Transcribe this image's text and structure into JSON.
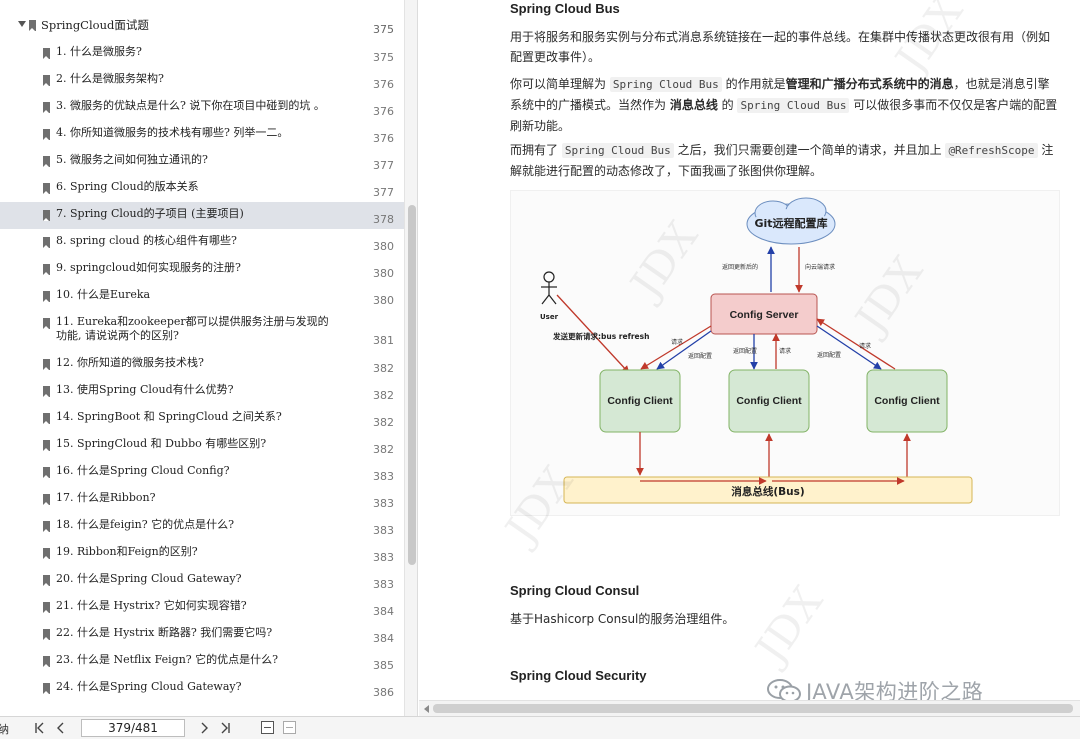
{
  "sidebar": {
    "root": {
      "label": "SpringCloud面试题",
      "page": "375"
    },
    "items": [
      {
        "label": "1. 什么是微服务?",
        "page": "375"
      },
      {
        "label": "2. 什么是微服务架构?",
        "page": "376"
      },
      {
        "label": "3. 微服务的优缺点是什么? 说下你在项目中碰到的坑 。",
        "page": "376"
      },
      {
        "label": "4. 你所知道微服务的技术栈有哪些? 列举一二。",
        "page": "376"
      },
      {
        "label": "5. 微服务之间如何独立通讯的?",
        "page": "377"
      },
      {
        "label": "6. Spring Cloud的版本关系",
        "page": "377"
      },
      {
        "label": "7. Spring Cloud的子项目 (主要项目)",
        "page": "378"
      },
      {
        "label": "8. spring cloud 的核心组件有哪些?",
        "page": "380"
      },
      {
        "label": "9. springcloud如何实现服务的注册?",
        "page": "380"
      },
      {
        "label": "10. 什么是Eureka",
        "page": "380"
      },
      {
        "label": "11. Eureka和zookeeper都可以提供服务注册与发现的功能, 请说说两个的区别?",
        "page": "381"
      },
      {
        "label": "12. 你所知道的微服务技术栈?",
        "page": "382"
      },
      {
        "label": "13. 使用Spring Cloud有什么优势?",
        "page": "382"
      },
      {
        "label": "14. SpringBoot 和 SpringCloud 之间关系?",
        "page": "382"
      },
      {
        "label": "15. SpringCloud 和 Dubbo 有哪些区别?",
        "page": "382"
      },
      {
        "label": "16. 什么是Spring Cloud Config?",
        "page": "383"
      },
      {
        "label": "17. 什么是Ribbon?",
        "page": "383"
      },
      {
        "label": "18. 什么是feigin? 它的优点是什么?",
        "page": "383"
      },
      {
        "label": "19. Ribbon和Feign的区别?",
        "page": "383"
      },
      {
        "label": "20. 什么是Spring Cloud Gateway?",
        "page": "383"
      },
      {
        "label": "21. 什么是 Hystrix? 它如何实现容错?",
        "page": "384"
      },
      {
        "label": "22. 什么是 Hystrix 断路器? 我们需要它吗?",
        "page": "384"
      },
      {
        "label": "23. 什么是 Netflix Feign? 它的优点是什么?",
        "page": "385"
      },
      {
        "label": "24. 什么是Spring Cloud Gateway?",
        "page": "386"
      }
    ]
  },
  "doc": {
    "bus_title": "Spring Cloud Bus",
    "bus_p1": "用于将服务和服务实例与分布式消息系统链接在一起的事件总线。在集群中传播状态更改很有用（例如配置更改事件）。",
    "bus_p2_a": "你可以简单理解为 ",
    "bus_p2_code": "Spring Cloud Bus",
    "bus_p2_b": " 的作用就是",
    "bus_p2_bold1": "管理和广播分布式系统中的消息",
    "bus_p2_c": "，也就是消息引擎系统中的广播模式。当然作为 ",
    "bus_p2_bold2": "消息总线",
    "bus_p2_d": " 的 ",
    "bus_p2_code2": "Spring Cloud Bus",
    "bus_p2_e": " 可以做很多事而不仅仅是客户端的配置刷新功能。",
    "bus_p3_a": "而拥有了 ",
    "bus_p3_code": "Spring Cloud Bus",
    "bus_p3_b": " 之后，我们只需要创建一个简单的请求，并且加上 ",
    "bus_p3_code2": "@RefreshScope",
    "bus_p3_c": " 注解就能进行配置的动态修改了，下面我画了张图供你理解。",
    "consul_title": "Spring Cloud Consul",
    "consul_p": "基于Hashicorp Consul的服务治理组件。",
    "security_title": "Spring Cloud Security"
  },
  "diagram": {
    "git_repo": "Git远程配置库",
    "return_update": "返回更新后的",
    "pull_request": "向云端请求",
    "user": "User",
    "send_update": "发送更新请求:bus refresh",
    "config_server": "Config Server",
    "request": "请求",
    "return_config": "返回配置",
    "config_client": "Config Client",
    "message_bus": "消息总线(Bus)",
    "watermark": "JDX"
  },
  "wechat": {
    "text": "JAVA架构进阶之路"
  },
  "statusbar": {
    "left_label": "纳",
    "page_indicator": "379/481"
  },
  "colors": {
    "server_fill": "#f4cccc",
    "server_stroke": "#b85450",
    "client_fill": "#d5e8d4",
    "client_stroke": "#82b366",
    "bus_fill": "#fff2cc",
    "bus_stroke": "#d6b656",
    "git_fill": "#dae8fc",
    "arrow_red": "#c0392b",
    "arrow_blue": "#2340a8",
    "active_row": "#dfe2e8"
  }
}
